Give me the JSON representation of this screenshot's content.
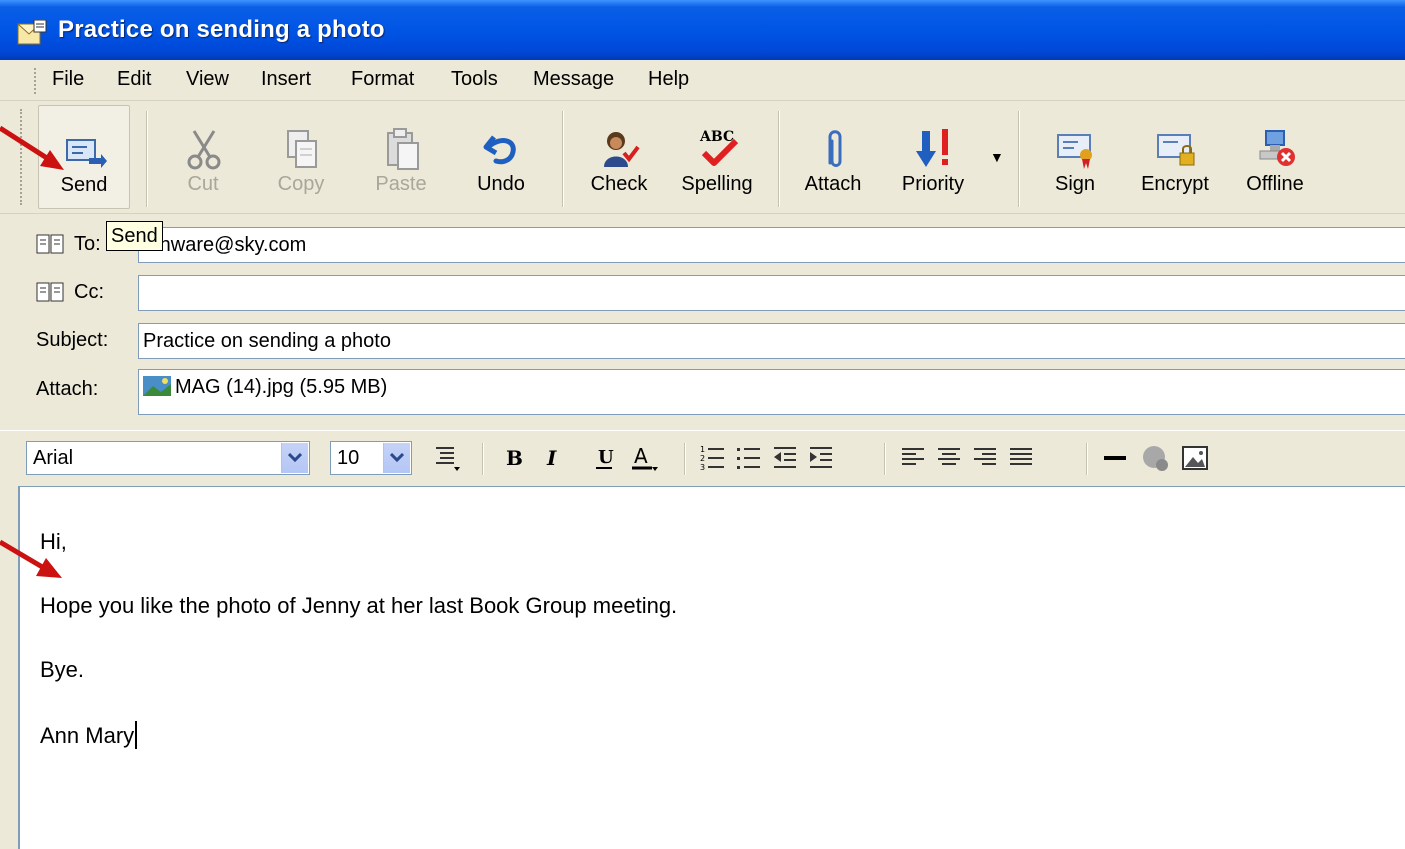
{
  "window": {
    "title": "Practice on sending a photo"
  },
  "menu": [
    "File",
    "Edit",
    "View",
    "Insert",
    "Format",
    "Tools",
    "Message",
    "Help"
  ],
  "toolbar": {
    "send": "Send",
    "cut": "Cut",
    "copy": "Copy",
    "paste": "Paste",
    "undo": "Undo",
    "check": "Check",
    "spelling": "Spelling",
    "attach": "Attach",
    "priority": "Priority",
    "sign": "Sign",
    "encrypt": "Encrypt",
    "offline": "Offline"
  },
  "tooltip": "Send",
  "fields": {
    "to_label": "To:",
    "to_value": "...nware@sky.com",
    "cc_label": "Cc:",
    "cc_value": "",
    "subject_label": "Subject:",
    "subject_value": "Practice on sending a photo",
    "attach_label": "Attach:",
    "attach_value": "MAG (14).jpg (5.95 MB)"
  },
  "format": {
    "font": "Arial",
    "size": "10"
  },
  "body": {
    "line1": "Hi,",
    "line2": "Hope you like the photo of Jenny at her last Book Group meeting.",
    "line3": "Bye.",
    "line4": "Ann Mary"
  },
  "colors": {
    "titlebar": "#0055e5",
    "arrow": "#cc1111",
    "tooltip_bg": "#ffffe1"
  },
  "icons": [
    "send-icon",
    "cut-icon",
    "copy-icon",
    "paste-icon",
    "undo-icon",
    "check-icon",
    "spelling-icon",
    "attach-icon",
    "priority-icon",
    "sign-icon",
    "encrypt-icon",
    "offline-icon"
  ]
}
